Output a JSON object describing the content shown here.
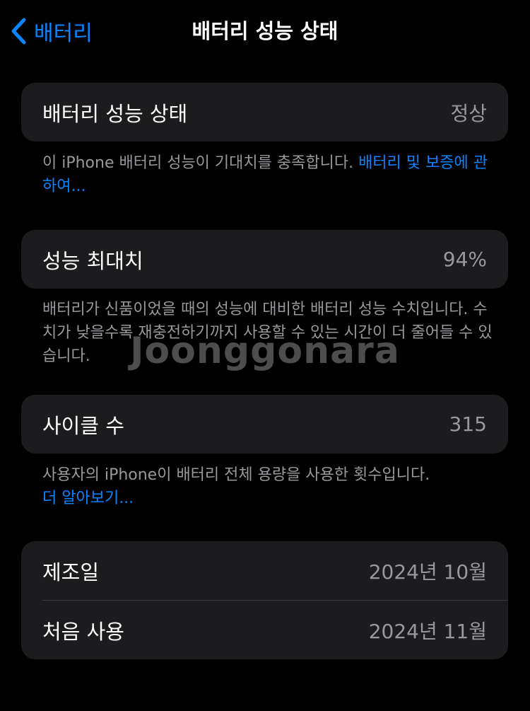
{
  "nav": {
    "back_label": "배터리",
    "title": "배터리 성능 상태"
  },
  "health_card": {
    "label": "배터리 성능 상태",
    "value": "정상"
  },
  "health_footnote": {
    "text": "이 iPhone 배터리 성능이 기대치를 충족합니다. ",
    "link": "배터리 및 보증에 관하여..."
  },
  "capacity_card": {
    "label": "성능 최대치",
    "value": "94%"
  },
  "capacity_footnote": {
    "text": "배터리가 신품이었을 때의 성능에 대비한 배터리 성능 수치입니다. 수치가 낮을수록 재충전하기까지 사용할 수 있는 시간이 더 줄어들 수 있습니다."
  },
  "cycle_card": {
    "label": "사이클 수",
    "value": "315"
  },
  "cycle_footnote": {
    "text": "사용자의 iPhone이 배터리 전체 용량을 사용한 횟수입니다.",
    "link": "더 알아보기..."
  },
  "dates_card": {
    "manufacture_label": "제조일",
    "manufacture_value": "2024년 10월",
    "first_use_label": "처음 사용",
    "first_use_value": "2024년 11월"
  },
  "watermark": {
    "text": "Joonggonara"
  },
  "colors": {
    "background": "#000000",
    "card": "#1c1c1e",
    "accent": "#0a84ff",
    "secondary_text": "#98989d"
  }
}
